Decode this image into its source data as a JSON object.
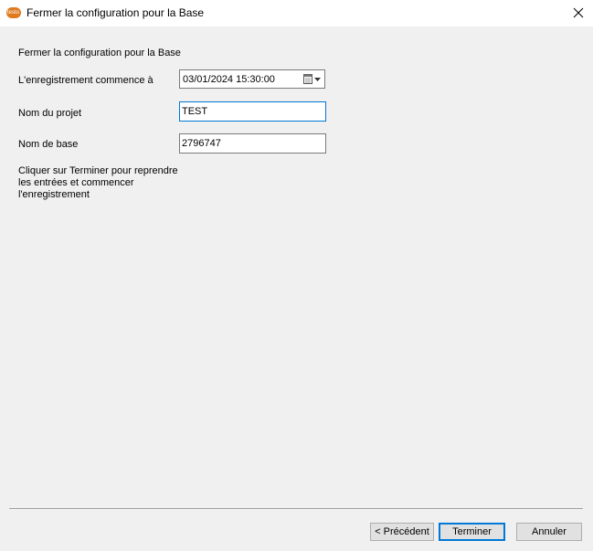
{
  "window": {
    "title": "Fermer la configuration pour la Base",
    "app_icon_text": "testo"
  },
  "form": {
    "heading": "Fermer la configuration pour la Base",
    "start_label": "L'enregistrement commence à",
    "start_value": "03/01/2024 15:30:00",
    "project_label": "Nom du projet",
    "project_value": "TEST",
    "base_label": "Nom de base",
    "base_value": "2796747",
    "note_lines": [
      "Cliquer sur Terminer pour reprendre",
      "les entrées et commencer",
      "l'enregistrement"
    ]
  },
  "buttons": {
    "previous": "< Précédent",
    "finish": "Terminer",
    "cancel": "Annuler"
  },
  "icons": {
    "app": "testo-logo-icon",
    "close": "close-icon",
    "calendar": "calendar-icon",
    "dropdown": "chevron-down-icon"
  },
  "colors": {
    "accent": "#0078d7",
    "app_icon": "#e07a1f"
  }
}
